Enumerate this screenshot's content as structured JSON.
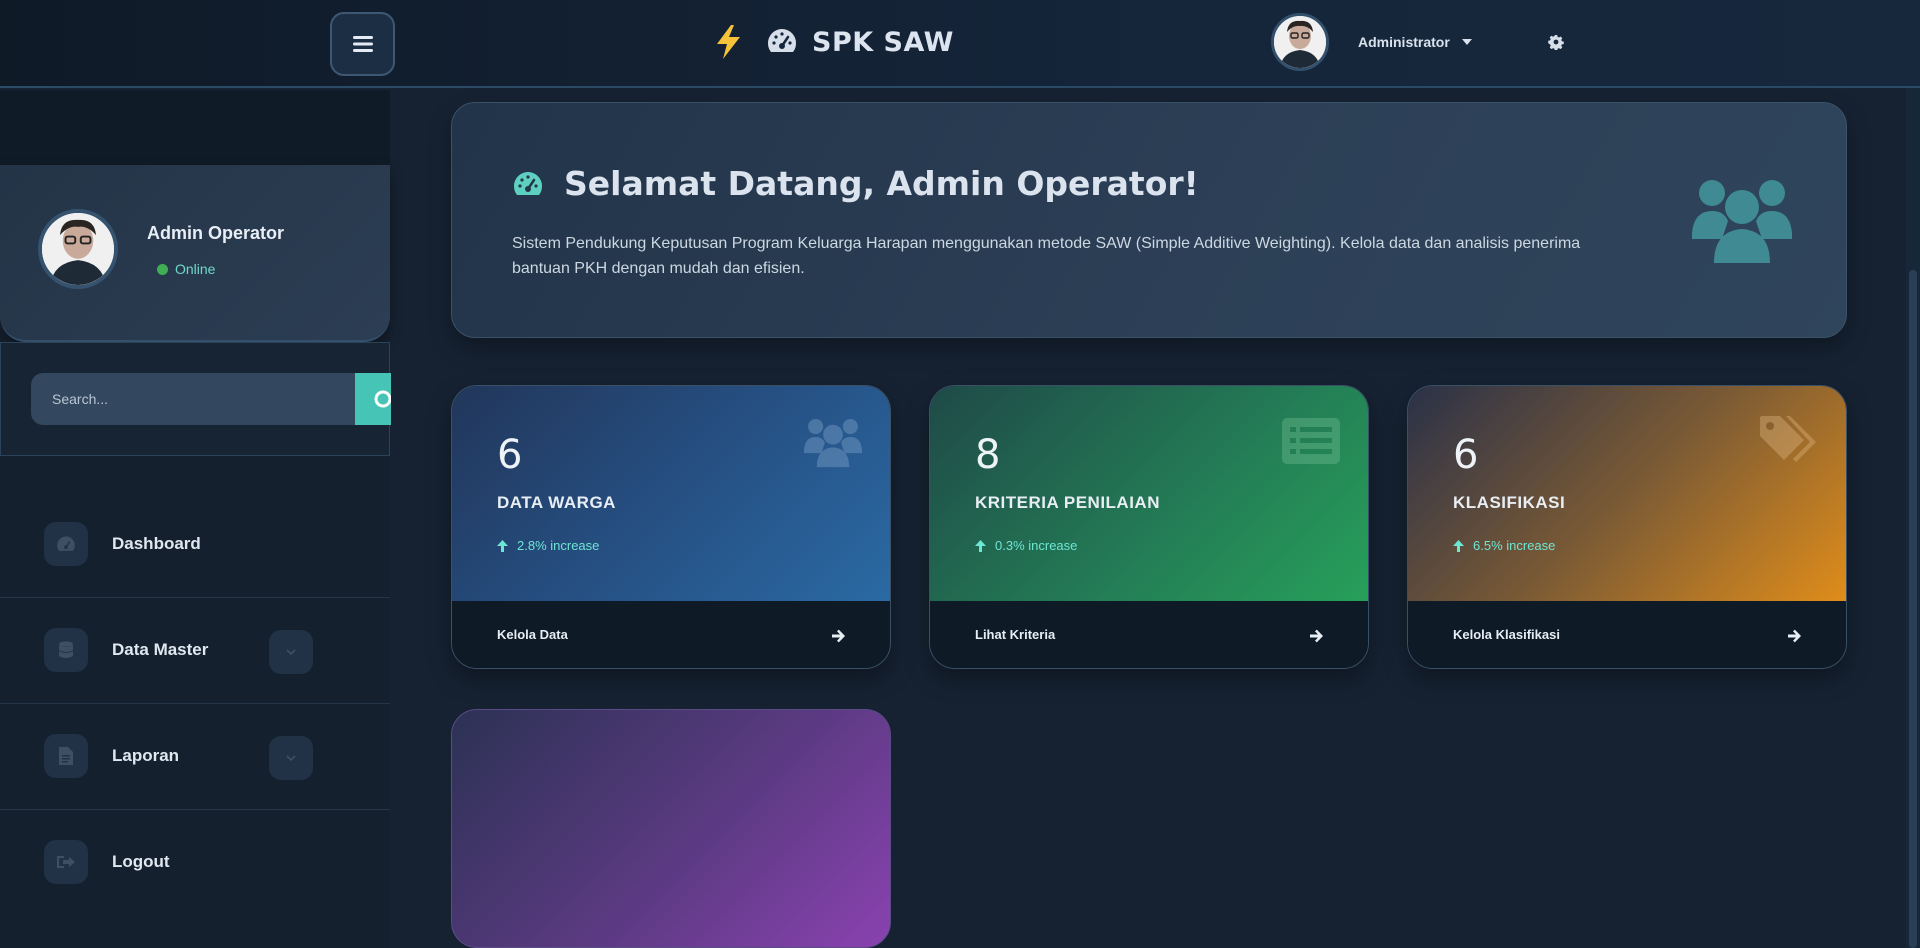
{
  "header": {
    "brand": "SPK SAW",
    "user_name": "Administrator",
    "icons": {
      "menu": "bars-icon",
      "bolt": "bolt-icon",
      "gauge": "gauge-icon",
      "settings": "gear-icon"
    }
  },
  "sidebar": {
    "profile": {
      "name": "Admin Operator",
      "status": "Online"
    },
    "search": {
      "placeholder": "Search..."
    },
    "items": [
      {
        "label": "Dashboard",
        "icon": "gauge-icon",
        "expandable": false
      },
      {
        "label": "Data Master",
        "icon": "database-icon",
        "expandable": true
      },
      {
        "label": "Laporan",
        "icon": "file-icon",
        "expandable": true
      },
      {
        "label": "Logout",
        "icon": "sign-out-icon",
        "expandable": false
      }
    ]
  },
  "welcome": {
    "title": "Selamat Datang, Admin Operator!",
    "description": "Sistem Pendukung Keputusan Program Keluarga Harapan menggunakan metode SAW (Simple Additive Weighting). Kelola data dan analisis penerima bantuan PKH dengan mudah dan efisien."
  },
  "cards": [
    {
      "value": "6",
      "title": "DATA WARGA",
      "increase": "2.8% increase",
      "link": "Kelola Data",
      "icon": "users-icon"
    },
    {
      "value": "8",
      "title": "KRITERIA PENILAIAN",
      "increase": "0.3% increase",
      "link": "Lihat Kriteria",
      "icon": "list-icon"
    },
    {
      "value": "6",
      "title": "KLASIFIKASI",
      "increase": "6.5% increase",
      "link": "Kelola Klasifikasi",
      "icon": "tags-icon"
    }
  ],
  "colors": {
    "accent": "#46c4b5",
    "card_blue": "#2a6aa3",
    "card_green": "#27a05a",
    "card_orange": "#e08d1a",
    "card_purple": "#8a42b0",
    "online": "#3fae55"
  }
}
